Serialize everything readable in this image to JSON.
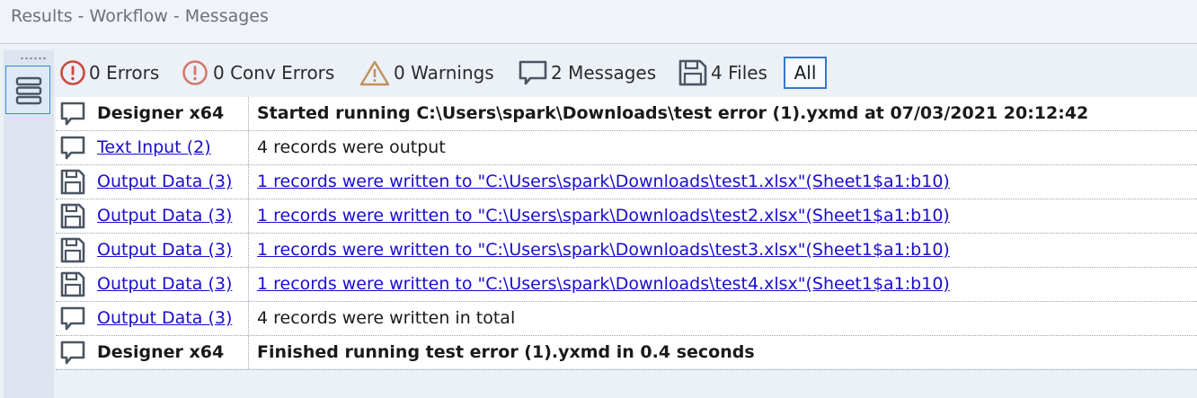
{
  "window": {
    "title": "Results - Workflow - Messages"
  },
  "panel_button": {
    "icon": "list-panel-icon"
  },
  "toolbar": {
    "errors": {
      "icon": "error-circle-icon",
      "label": "0 Errors"
    },
    "conv_errors": {
      "icon": "conv-error-circle-icon",
      "label": "0 Conv Errors"
    },
    "warnings": {
      "icon": "warning-triangle-icon",
      "label": "0 Warnings"
    },
    "messages": {
      "icon": "message-bubble-icon",
      "label": "2 Messages"
    },
    "files": {
      "icon": "file-save-icon",
      "label": "4 Files"
    },
    "all": {
      "label": "All"
    }
  },
  "colors": {
    "error": "#c94a3c",
    "warning": "#c1915c",
    "icon": "#4b5563",
    "link": "#1a0dcc",
    "selected_border": "#2e7bd1"
  },
  "rows": [
    {
      "icon": "message-bubble-icon",
      "tool": "Designer x64",
      "message": "Started running C:\\Users\\spark\\Downloads\\test error (1).yxmd at 07/03/2021 20:12:42",
      "bold": true,
      "tool_link": false,
      "message_link": false
    },
    {
      "icon": "message-bubble-icon",
      "tool": "Text Input (2)",
      "message": "4 records were output",
      "bold": false,
      "tool_link": true,
      "message_link": false
    },
    {
      "icon": "file-save-icon",
      "tool": "Output Data (3)",
      "message": "1 records were written to \"C:\\Users\\spark\\Downloads\\test1.xlsx\"(Sheet1$a1:b10)",
      "bold": false,
      "tool_link": true,
      "message_link": true
    },
    {
      "icon": "file-save-icon",
      "tool": "Output Data (3)",
      "message": "1 records were written to \"C:\\Users\\spark\\Downloads\\test2.xlsx\"(Sheet1$a1:b10)",
      "bold": false,
      "tool_link": true,
      "message_link": true
    },
    {
      "icon": "file-save-icon",
      "tool": "Output Data (3)",
      "message": "1 records were written to \"C:\\Users\\spark\\Downloads\\test3.xlsx\"(Sheet1$a1:b10)",
      "bold": false,
      "tool_link": true,
      "message_link": true
    },
    {
      "icon": "file-save-icon",
      "tool": "Output Data (3)",
      "message": "1 records were written to \"C:\\Users\\spark\\Downloads\\test4.xlsx\"(Sheet1$a1:b10)",
      "bold": false,
      "tool_link": true,
      "message_link": true
    },
    {
      "icon": "message-bubble-icon",
      "tool": "Output Data (3)",
      "message": "4 records were written in total",
      "bold": false,
      "tool_link": true,
      "message_link": false
    },
    {
      "icon": "message-bubble-icon",
      "tool": "Designer x64",
      "message": "Finished running test error (1).yxmd in 0.4 seconds",
      "bold": true,
      "tool_link": false,
      "message_link": false
    }
  ]
}
